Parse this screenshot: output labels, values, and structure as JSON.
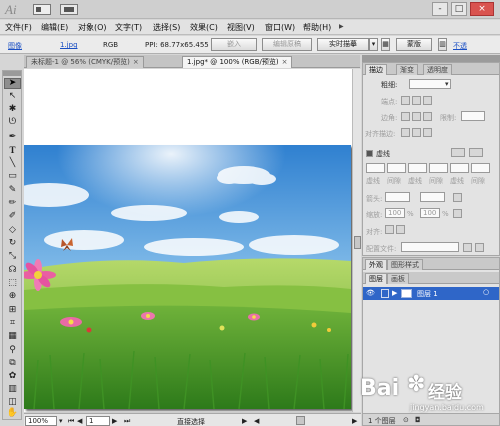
{
  "app": {
    "logo": "Ai"
  },
  "window_controls": {
    "minimize": "-",
    "maximize": "□",
    "close": "×"
  },
  "menu": {
    "items": [
      "文件(F)",
      "编辑(E)",
      "对象(O)",
      "文字(T)",
      "选择(S)",
      "效果(C)",
      "视图(V)",
      "窗口(W)",
      "帮助(H)"
    ]
  },
  "control_bar": {
    "type_label": "图像",
    "file_link": "1.jpg",
    "color_mode": "RGB",
    "ppi": "PPI: 68.77x65.455",
    "embed_button": "嵌入",
    "edit_original_button": "编辑原稿",
    "live_trace_button": "实时描摹",
    "mask_button": "蒙版",
    "opacity_link": "不透"
  },
  "tabs": [
    {
      "label": "未标题-1 @ 56% (CMYK/预览)",
      "close": "×",
      "active": false
    },
    {
      "label": "1.jpg* @ 100% (RGB/预览)",
      "close": "×",
      "active": true
    }
  ],
  "status_bar": {
    "zoom": "100%",
    "page": "1",
    "tool_label": "直接选择"
  },
  "stroke_panel": {
    "tabs": [
      "描边",
      "渐变",
      "透明度"
    ],
    "weight_label": "粗细:",
    "cap_label": "端点:",
    "corner_label": "边角:",
    "limit_label": "限制:",
    "align_label": "对齐描边:",
    "dashed_label": "虚线",
    "dash_fields": [
      "虚线",
      "间隙",
      "虚线",
      "间隙",
      "虚线",
      "间隙"
    ],
    "arrow_label": "箭头:",
    "scale_label": "缩放:",
    "scale_values": [
      "100",
      "100"
    ],
    "scale_unit": "%",
    "align_arrow_label": "对齐:",
    "profile_label": "配置文件:"
  },
  "layers_panel": {
    "top_tabs": [
      "外观",
      "图形样式"
    ],
    "sub_tabs": [
      "图层",
      "画板"
    ],
    "layer_name": "图层 1",
    "footer": "1 个图层"
  },
  "watermark": {
    "brand": "Bai",
    "brand2": "经验",
    "url": "jingyan.baidu.com"
  },
  "colors": {
    "accent_blue": "#2f66c8",
    "sky_top": "#2f80d0",
    "grass": "#5aa22c"
  }
}
